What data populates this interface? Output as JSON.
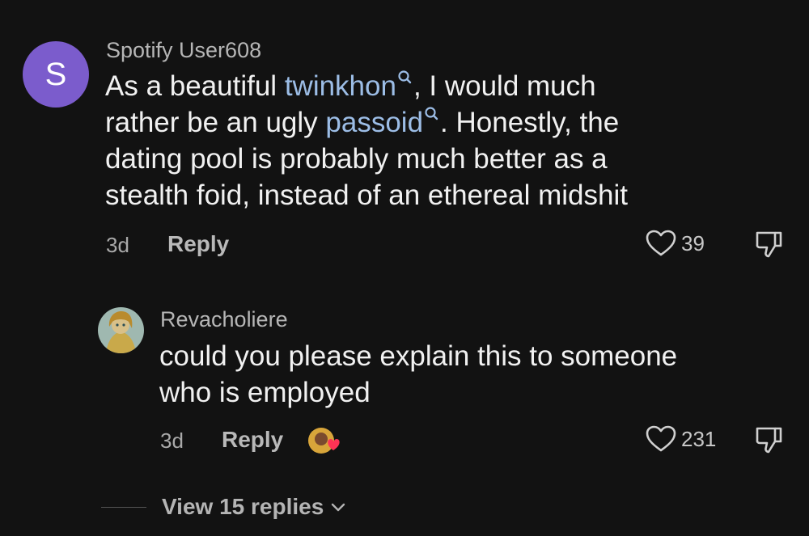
{
  "comment": {
    "avatar_letter": "S",
    "username": "Spotify User608",
    "text_parts": {
      "p1": "As a beautiful ",
      "link1": "twinkhon",
      "p2": ", I would much",
      "p3": "rather be an ugly ",
      "link2": "passoid",
      "p4": ". Honestly, the",
      "line3": "dating pool is probably much better as a",
      "line4": "stealth foid, instead of an ethereal midshit"
    },
    "time": "3d",
    "reply_label": "Reply",
    "likes": "39"
  },
  "reply": {
    "username": "Revacholiere",
    "line1": "could you please explain this to someone",
    "line2": "who is employed",
    "time": "3d",
    "reply_label": "Reply",
    "likes": "231"
  },
  "view_replies_label": "View 15 replies",
  "colors": {
    "background": "#121212",
    "avatar": "#7b5ccc",
    "link": "#9cbde6",
    "text": "#f1f1f1",
    "muted": "#b6b6b6"
  },
  "icons": [
    "search-icon",
    "heart-icon",
    "thumbs-down-icon",
    "chevron-down-icon"
  ]
}
